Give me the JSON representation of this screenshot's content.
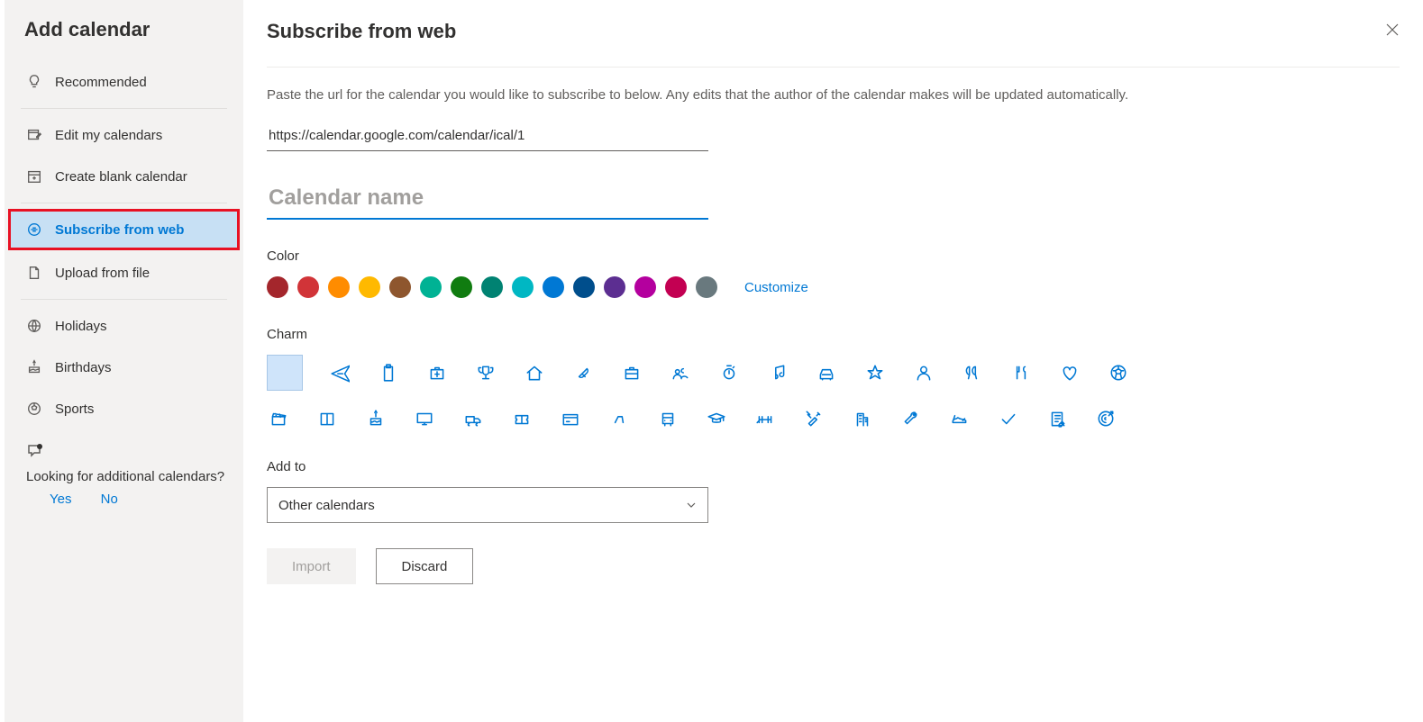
{
  "sidebar": {
    "title": "Add calendar",
    "items": {
      "recommended": "Recommended",
      "edit": "Edit my calendars",
      "blank": "Create blank calendar",
      "subscribe": "Subscribe from web",
      "upload": "Upload from file",
      "holidays": "Holidays",
      "birthdays": "Birthdays",
      "sports": "Sports"
    },
    "looking": "Looking for additional calendars?",
    "yes": "Yes",
    "no": "No"
  },
  "main": {
    "title": "Subscribe from web",
    "description": "Paste the url for the calendar you would like to subscribe to below. Any edits that the author of the calendar makes will be updated automatically.",
    "url_value": "https://calendar.google.com/calendar/ical/1",
    "name_placeholder": "Calendar name",
    "color_label": "Color",
    "customize": "Customize",
    "charm_label": "Charm",
    "addto_label": "Add to",
    "addto_value": "Other calendars",
    "btn_import": "Import",
    "btn_discard": "Discard"
  },
  "colors": [
    "#a4262c",
    "#d13438",
    "#ff8c00",
    "#ffb900",
    "#8e562e",
    "#00b294",
    "#107c10",
    "#008272",
    "#00b7c3",
    "#0078d4",
    "#004e8c",
    "#5c2e91",
    "#b4009e",
    "#c30052",
    "#69797e"
  ],
  "charms": [
    "none",
    "plane",
    "clipboard",
    "firstaid",
    "trophy",
    "home",
    "pill",
    "briefcase",
    "people",
    "stopwatch",
    "music",
    "car",
    "star",
    "person",
    "balloons",
    "food",
    "heart",
    "soccer",
    "clapper",
    "book",
    "cake",
    "monitor",
    "truck",
    "ticket",
    "creditcard",
    "bike",
    "bus",
    "graduation",
    "dumbbell",
    "tools",
    "building",
    "wrench",
    "shoe",
    "check",
    "notes",
    "target"
  ]
}
